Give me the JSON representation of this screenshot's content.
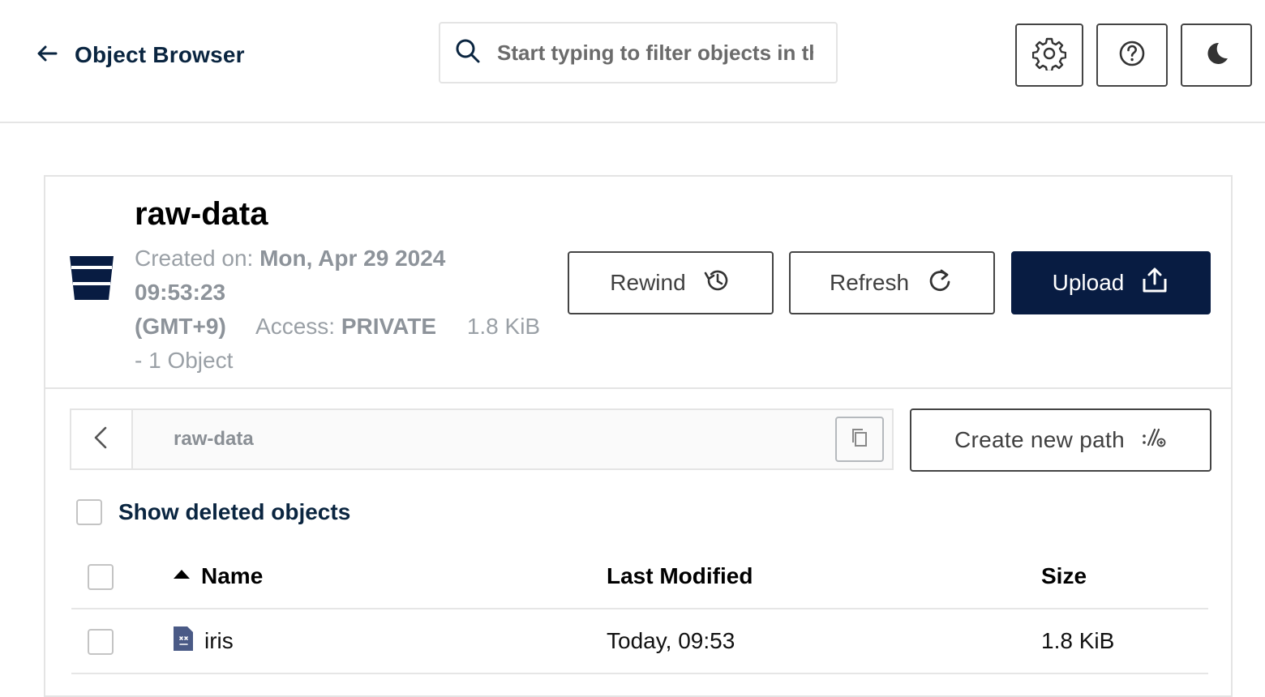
{
  "header": {
    "back_title": "Object Browser",
    "search_placeholder": "Start typing to filter objects in the bucket",
    "icons": [
      "back-arrow-icon",
      "search-icon",
      "gear-icon",
      "help-icon",
      "moon-icon"
    ]
  },
  "bucket": {
    "name": "raw-data",
    "created_label": "Created on:",
    "created_date": "Mon, Apr 29 2024",
    "created_time": "09:53:23",
    "timezone": "(GMT+9)",
    "access_label": "Access:",
    "access_value": "PRIVATE",
    "size": "1.8 KiB",
    "object_count": "- 1 Object",
    "accent_color": "#081c42"
  },
  "actions": {
    "rewind_label": "Rewind",
    "refresh_label": "Refresh",
    "upload_label": "Upload"
  },
  "browser": {
    "path": "raw-data",
    "create_path_label": "Create new path",
    "show_deleted_label": "Show deleted objects",
    "show_deleted_checked": false
  },
  "table": {
    "columns": {
      "name": "Name",
      "last_modified": "Last Modified",
      "size": "Size"
    },
    "sort": {
      "column": "name",
      "direction": "ascending"
    },
    "rows": [
      {
        "name": "iris",
        "last_modified": "Today, 09:53",
        "size": "1.8 KiB",
        "icon": "file-icon"
      }
    ]
  }
}
